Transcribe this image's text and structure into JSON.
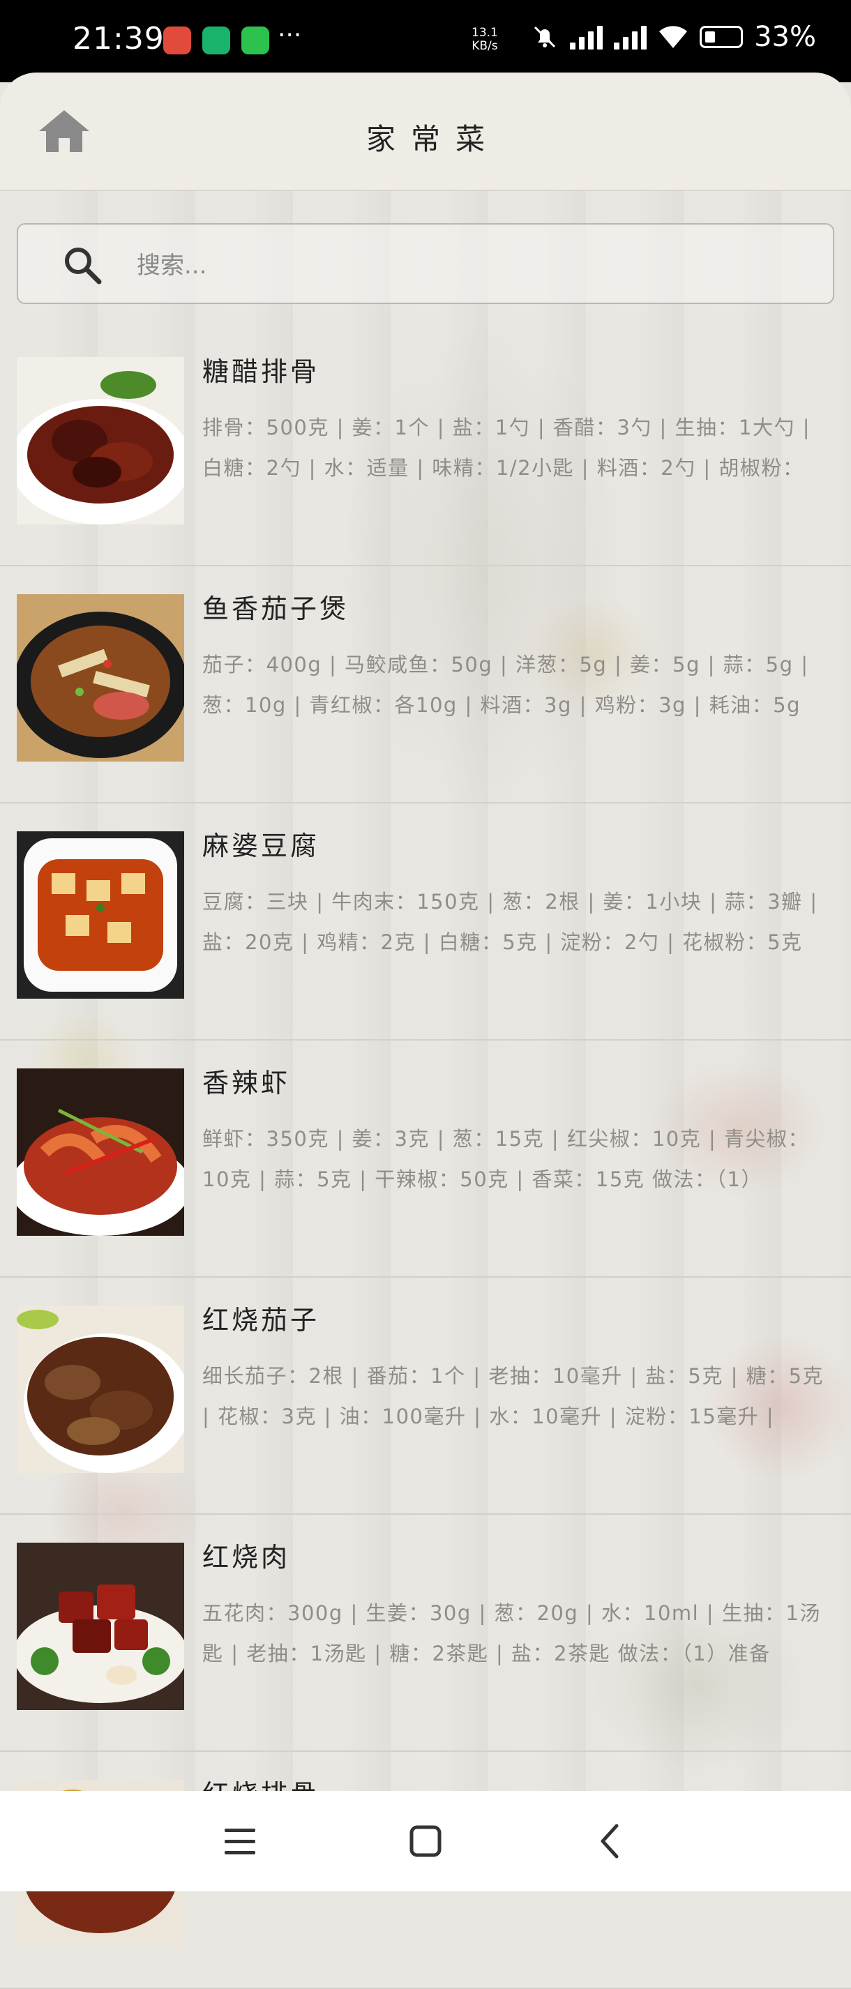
{
  "status_bar": {
    "time": "21:39",
    "more": "···",
    "net_speed_value": "13.1",
    "net_speed_unit": "KB/s",
    "battery": "33%"
  },
  "header": {
    "title": "家常菜",
    "home_icon": "home-icon"
  },
  "search": {
    "placeholder": "搜索...",
    "icon": "search-icon"
  },
  "recipes": [
    {
      "title": "糖醋排骨",
      "desc": "排骨：500克 | 姜：1个 | 盐：1勺 | 香醋：3勺 | 生抽：1大勺 | 白糖：2勺 | 水：适量 | 味精：1/2小匙 | 料酒：2勺 | 胡椒粉："
    },
    {
      "title": "鱼香茄子煲",
      "desc": "茄子：400g | 马鲛咸鱼：50g | 洋葱：5g | 姜：5g | 蒜：5g | 葱：10g | 青红椒：各10g | 料酒：3g | 鸡粉：3g | 耗油：5g"
    },
    {
      "title": "麻婆豆腐",
      "desc": "豆腐：三块 | 牛肉末：150克 | 葱：2根 | 姜：1小块 | 蒜：3瓣 | 盐：20克 | 鸡精：2克 | 白糖：5克 | 淀粉：2勺 | 花椒粉：5克"
    },
    {
      "title": "香辣虾",
      "desc": "鲜虾：350克 | 姜：3克 | 葱：15克 | 红尖椒：10克 | 青尖椒：10克 | 蒜：5克 | 干辣椒：50克 | 香菜：15克  做法：（1）"
    },
    {
      "title": "红烧茄子",
      "desc": "细长茄子：2根 | 番茄：1个 | 老抽：10毫升 | 盐：5克 | 糖：5克 | 花椒：3克 | 油：100毫升 | 水：10毫升 | 淀粉：15毫升 |"
    },
    {
      "title": "红烧肉",
      "desc": "五花肉：300g | 生姜：30g | 葱：20g | 水：10ml | 生抽：1汤匙 | 老抽：1汤匙 | 糖：2茶匙 | 盐：2茶匙  做法：（1）准备"
    },
    {
      "title": "红烧排骨",
      "desc": ""
    }
  ],
  "nav_bar": {
    "menu_icon": "menu-icon",
    "home_icon": "square-home-icon",
    "back_icon": "back-chevron-icon"
  },
  "colors": {
    "header_bg": "#eeece5",
    "title_text": "#222222",
    "desc_text": "#8f8d88",
    "divider": "#d2d0cb"
  }
}
